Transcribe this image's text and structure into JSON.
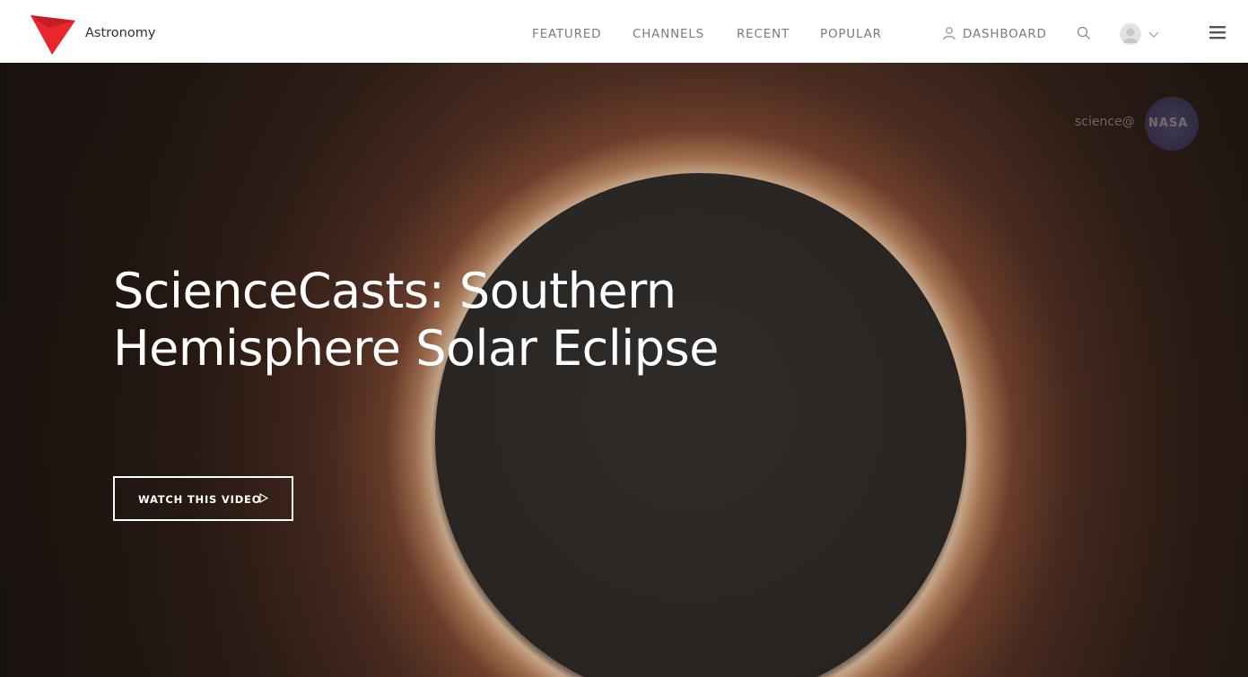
{
  "brand": {
    "name": "Astronomy",
    "logo_icon": "paper-plane-logo-icon",
    "accent": "#e8262d"
  },
  "nav": {
    "items": [
      {
        "label": "FEATURED"
      },
      {
        "label": "CHANNELS"
      },
      {
        "label": "RECENT"
      },
      {
        "label": "POPULAR"
      }
    ],
    "dashboard": {
      "label": "DASHBOARD",
      "icon": "user-icon"
    },
    "search_icon": "search-icon",
    "avatar_icon": "avatar-icon",
    "dropdown_icon": "chevron-down-icon",
    "menu_icon": "hamburger-menu-icon"
  },
  "hero": {
    "title": "ScienceCasts: Southern Hemisphere Solar Eclipse",
    "cta": {
      "label": "WATCH THIS VIDEO",
      "icon": "play-icon"
    },
    "watermark": {
      "prefix": "science@",
      "badge": "NASA"
    }
  }
}
